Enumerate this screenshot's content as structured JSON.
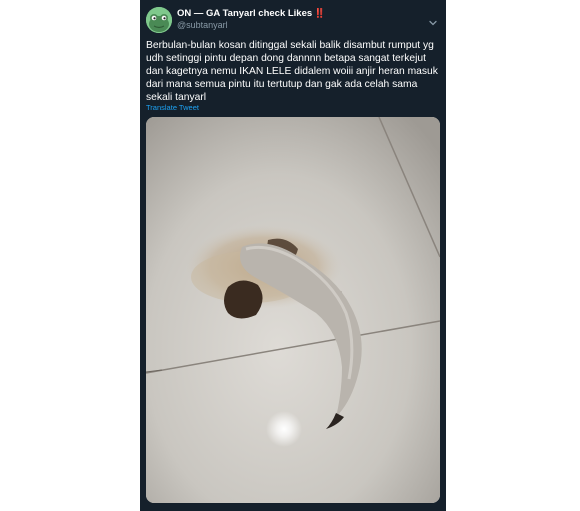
{
  "tweet": {
    "display_name": "ON — GA Tanyarl check Likes",
    "badge": "‼️",
    "handle": "@subtanyarl",
    "text": "Berbulan-bulan kosan ditinggal sekali balik disambut rumput yg udh setinggi pintu depan dong dannnn betapa sangat terkejut dan kagetnya nemu IKAN LELE didalem woiii anjir heran masuk dari mana semua pintu itu tertutup dan gak ada celah sama sekali tanyarl",
    "translate_label": "Translate Tweet",
    "caret_icon": "chevron-down-icon",
    "avatar_icon": "frog-avatar",
    "media_alt": "dried catfish on a tiled floor"
  },
  "colors": {
    "background": "#15202b",
    "text": "#ffffff",
    "secondary": "#8899a6",
    "link": "#1da1f2",
    "badge": "#e0245e"
  }
}
